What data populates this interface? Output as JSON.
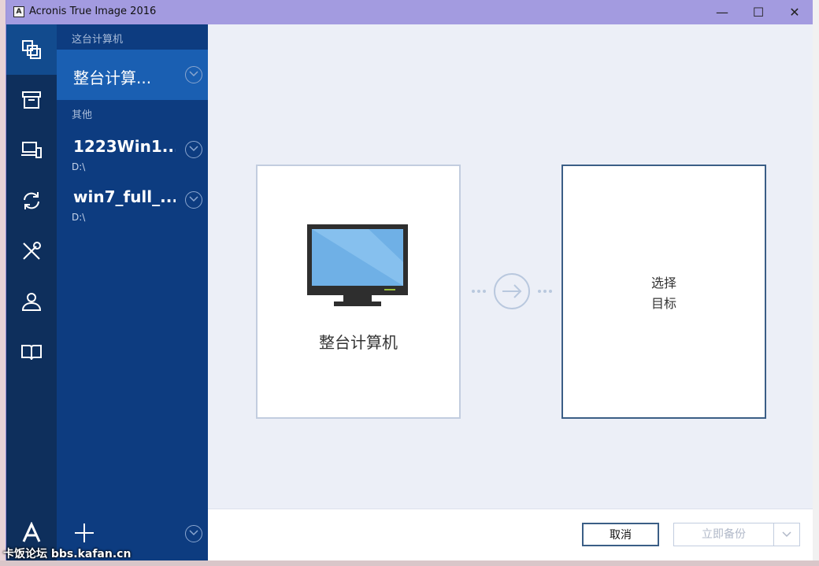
{
  "window": {
    "title": "Acronis True Image 2016",
    "app_icon": "A",
    "minimize_glyph": "—",
    "maximize_glyph": "☐",
    "close_glyph": "✕"
  },
  "rail": {
    "items": [
      {
        "name": "backup-icon",
        "active": true
      },
      {
        "name": "archive-icon",
        "active": false
      },
      {
        "name": "devices-icon",
        "active": false
      },
      {
        "name": "sync-icon",
        "active": false
      },
      {
        "name": "tools-icon",
        "active": false
      },
      {
        "name": "account-icon",
        "active": false
      },
      {
        "name": "help-book-icon",
        "active": false
      }
    ],
    "logo": "A"
  },
  "panel": {
    "this_computer_label": "这台计算机",
    "selected_source": "整台计算...",
    "other_label": "其他",
    "backups": [
      {
        "name": "1223Win1...",
        "path": "D:\\"
      },
      {
        "name": "win7_full_...",
        "path": "D:\\"
      }
    ]
  },
  "main": {
    "source_card_label": "整台计算机",
    "destination_label": "选择\n目标"
  },
  "footer": {
    "cancel_label": "取消",
    "backup_now_label": "立即备份"
  },
  "watermark": "卡饭论坛 bbs.kafan.cn",
  "colors": {
    "rail_bg": "#0e2f5c",
    "panel_bg": "#0d3c80",
    "selected_bg": "#1a5fb2",
    "accent_border": "#3b5e86",
    "titlebar": "#a39be0"
  }
}
